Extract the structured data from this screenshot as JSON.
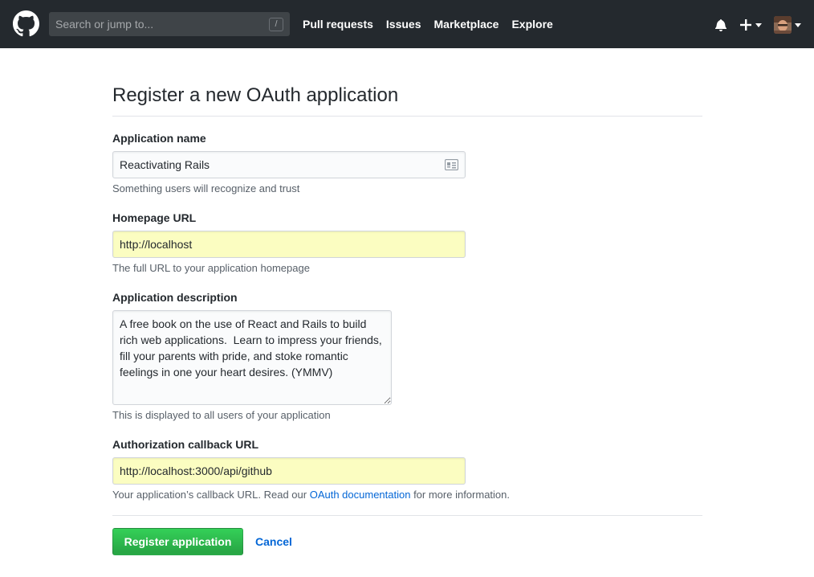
{
  "header": {
    "logo_icon": "github-octocat-icon",
    "search": {
      "placeholder": "Search or jump to...",
      "shortcut_key": "/"
    },
    "nav": [
      {
        "label": "Pull requests"
      },
      {
        "label": "Issues"
      },
      {
        "label": "Marketplace"
      },
      {
        "label": "Explore"
      }
    ],
    "notifications_icon": "bell-icon",
    "create_menu_icon": "plus-icon",
    "profile_menu_icon": "avatar"
  },
  "form": {
    "title": "Register a new OAuth application",
    "application_name": {
      "label": "Application name",
      "value": "Reactivating Rails",
      "note": "Something users will recognize and trust"
    },
    "homepage_url": {
      "label": "Homepage URL",
      "value": "http://localhost",
      "note": "The full URL to your application homepage"
    },
    "application_description": {
      "label": "Application description",
      "value": "A free book on the use of React and Rails to build rich web applications.  Learn to impress your friends, fill your parents with pride, and stoke romantic feelings in one your heart desires. (YMMV)",
      "note": "This is displayed to all users of your application"
    },
    "callback_url": {
      "label": "Authorization callback URL",
      "value": "http://localhost:3000/api/github",
      "note_before": "Your application’s callback URL. Read our ",
      "note_link": "OAuth documentation",
      "note_after": " for more information."
    },
    "submit_label": "Register application",
    "cancel_label": "Cancel"
  },
  "colors": {
    "header_bg": "#24292e",
    "autofill_bg": "#fbfdc1",
    "primary_button": "#28a745",
    "link": "#0366d6"
  }
}
